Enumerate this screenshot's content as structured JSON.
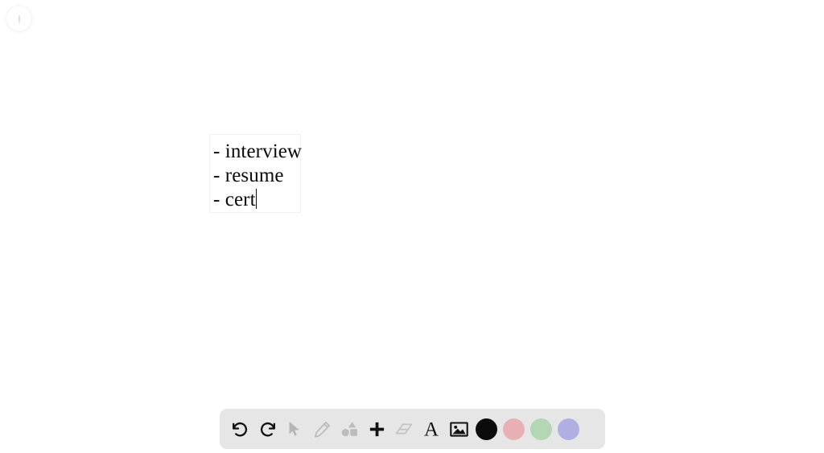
{
  "app": {
    "name": "whiteboard-canvas",
    "background_color": "#ffffff"
  },
  "menu_button": {
    "icon": "handle-icon",
    "label": ""
  },
  "text_box": {
    "name": "text-element",
    "border_color": "#f0f1f3",
    "text_color": "#0a0a0a",
    "font": "serif",
    "lines": [
      "- interview",
      "- resume",
      "- cert"
    ],
    "caret_visible": true,
    "caret_after_line_index": 2
  },
  "toolbar": {
    "background_color": "#e6e6e6",
    "active_color": "#111111",
    "inactive_color": "#b5b5b5",
    "tools": [
      {
        "name": "undo-button",
        "icon": "undo-icon",
        "label": "Undo",
        "state": "enabled"
      },
      {
        "name": "redo-button",
        "icon": "redo-icon",
        "label": "Redo",
        "state": "enabled"
      },
      {
        "name": "select-tool",
        "icon": "cursor-icon",
        "label": "Select",
        "state": "disabled"
      },
      {
        "name": "draw-tool",
        "icon": "pencil-icon",
        "label": "Draw",
        "state": "disabled"
      },
      {
        "name": "shapes-tool",
        "icon": "shapes-icon",
        "label": "Shapes",
        "state": "disabled"
      },
      {
        "name": "add-tool",
        "icon": "plus-icon",
        "label": "Add",
        "state": "enabled"
      },
      {
        "name": "eraser-tool",
        "icon": "eraser-icon",
        "label": "Eraser",
        "state": "disabled"
      },
      {
        "name": "text-tool",
        "icon": "text-a-icon",
        "label": "Text",
        "state": "selected"
      },
      {
        "name": "image-tool",
        "icon": "image-icon",
        "label": "Image",
        "state": "enabled"
      }
    ],
    "colors": [
      {
        "name": "color-swatch-black",
        "label": "Black",
        "hex": "#0b0b0b",
        "selected": true
      },
      {
        "name": "color-swatch-pink",
        "label": "Pink",
        "hex": "#e8b0b4",
        "selected": false
      },
      {
        "name": "color-swatch-green",
        "label": "Green",
        "hex": "#b5d6b2",
        "selected": false
      },
      {
        "name": "color-swatch-purple",
        "label": "Purple",
        "hex": "#b0afe4",
        "selected": false
      }
    ]
  }
}
